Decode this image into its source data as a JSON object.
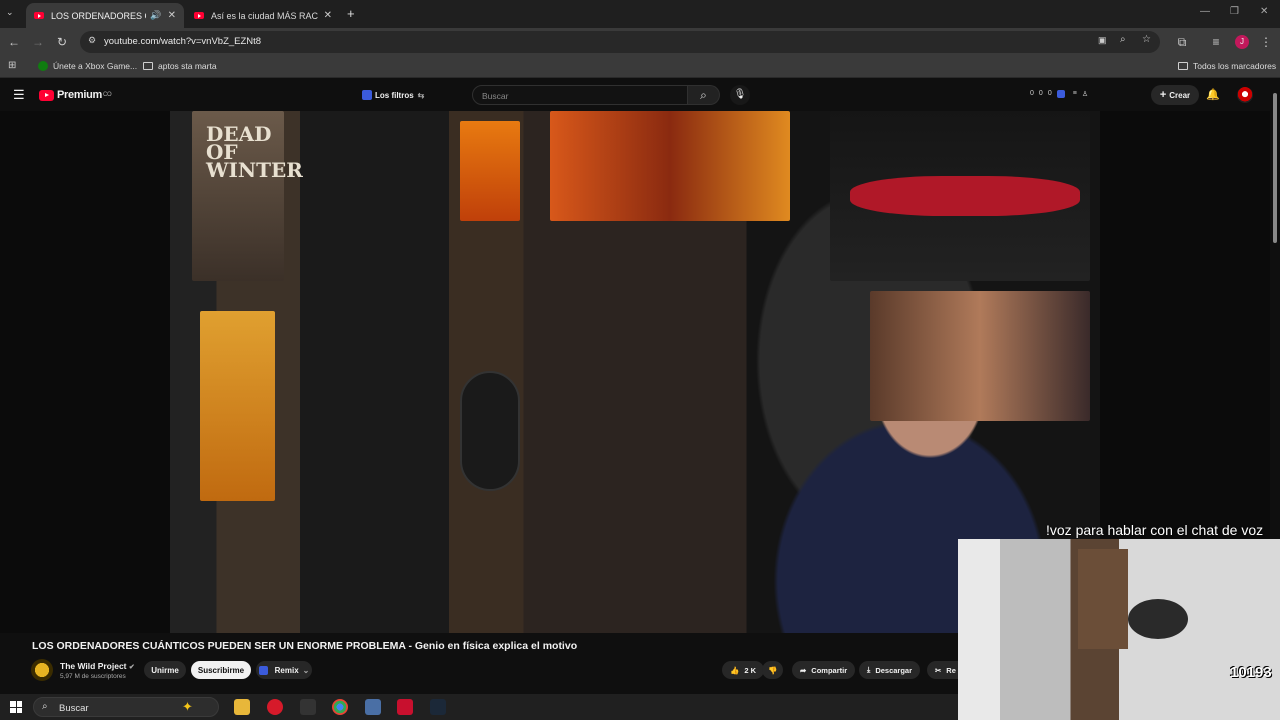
{
  "browser": {
    "tabs": [
      {
        "title": "LOS ORDENADORES CUÁNTICOS PUEDEN SER UN ENORME PROBLEMA",
        "active": true
      },
      {
        "title": "Así es la ciudad MÁS RACISTA de",
        "active": false
      }
    ],
    "new_tab": "+",
    "url": "youtube.com/watch?v=vnVbZ_EZNt8",
    "bookmarks": [
      {
        "label": "Únete a Xbox Game..."
      },
      {
        "label": "aptos sta marta"
      }
    ],
    "all_bookmarks": "Todos los marcadores",
    "profile_initial": "J"
  },
  "youtube": {
    "logo_text": "Premium",
    "logo_sup": "CO",
    "filters_label": "Los filtros",
    "search_placeholder": "Buscar",
    "counters": [
      "0",
      "0",
      "0"
    ],
    "create_label": "Crear"
  },
  "video": {
    "poster_text": "DEAD OF WINTER",
    "title": "LOS ORDENADORES CUÁNTICOS PUEDEN SER UN ENORME PROBLEMA - Genio en física explica el motivo",
    "channel": "The Wild Project",
    "subscribers": "5,97 M de suscriptores",
    "join_label": "Unirme",
    "subscribe_label": "Suscribirme",
    "remix_label": "Remix",
    "likes": "2 K",
    "share_label": "Compartir",
    "download_label": "Descargar",
    "clip_label": "Re"
  },
  "overlay": {
    "caption": "!voz para hablar con el chat de voz",
    "counter": "10193"
  },
  "taskbar": {
    "search_label": "Buscar"
  }
}
